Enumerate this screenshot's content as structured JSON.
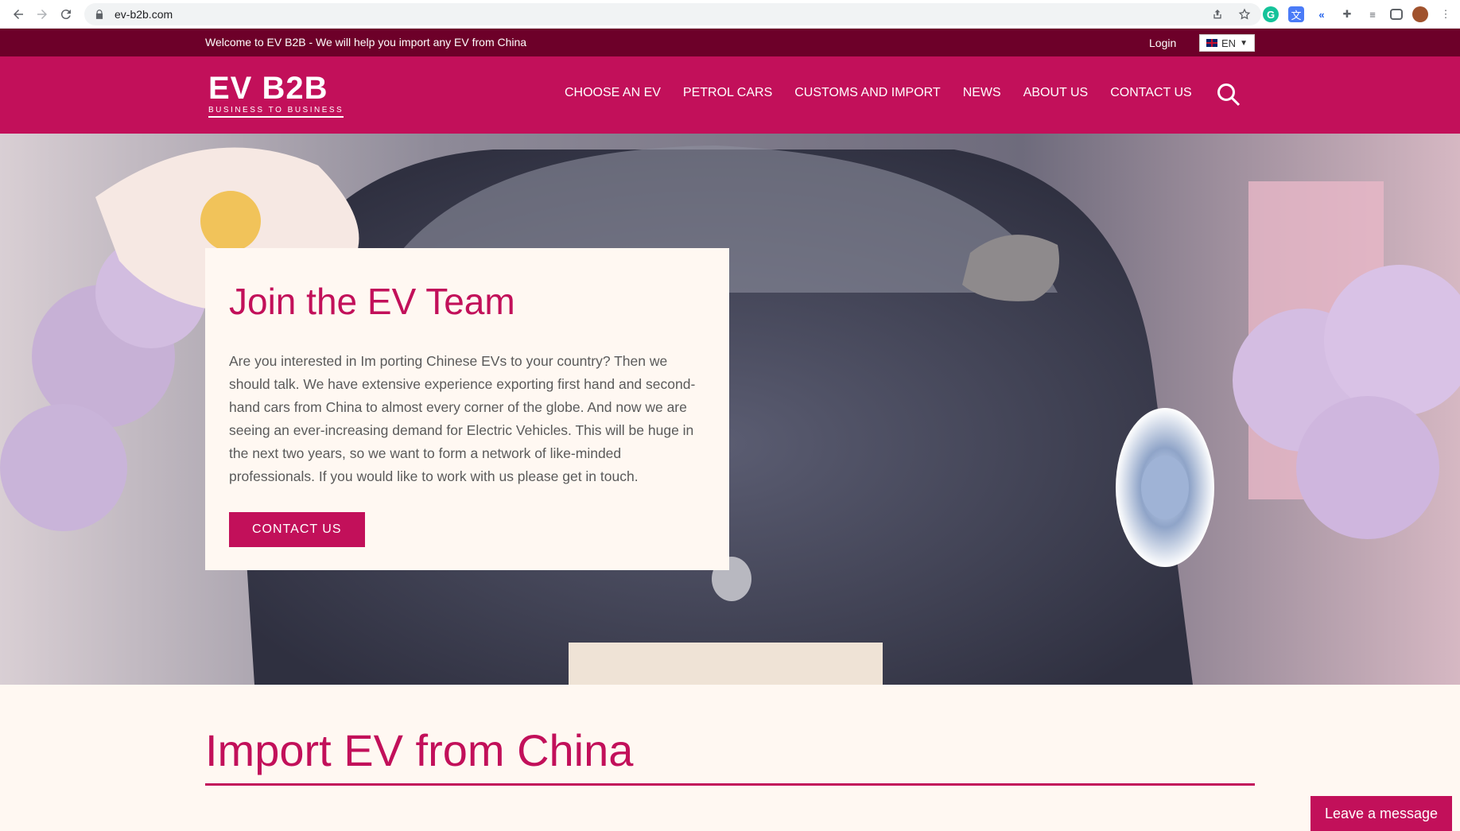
{
  "browser": {
    "url": "ev-b2b.com"
  },
  "topbar": {
    "welcome": "Welcome to EV B2B - We will help you import any EV from China",
    "login": "Login",
    "language": "EN"
  },
  "header": {
    "logo_main": "EV B2B",
    "logo_sub": "BUSINESS TO BUSINESS",
    "nav": [
      {
        "label": "CHOOSE AN EV"
      },
      {
        "label": "PETROL CARS"
      },
      {
        "label": "CUSTOMS AND IMPORT"
      },
      {
        "label": "NEWS"
      },
      {
        "label": "ABOUT US"
      },
      {
        "label": "CONTACT US"
      }
    ]
  },
  "hero": {
    "title": "Join the EV Team",
    "text": "Are you interested in Im porting Chinese EVs to your country? Then we should talk. We have extensive experience exporting first hand and second-hand cars from China to almost every corner of the globe. And now we are seeing an ever-increasing demand for Electric Vehicles. This will be huge in the next two years, so we want to form a network of like-minded professionals. If you would like to work with us please get in touch.",
    "button": "CONTACT US"
  },
  "section": {
    "title": "Import EV from China"
  },
  "chat": {
    "label": "Leave a message"
  },
  "colors": {
    "brand": "#c2105a",
    "topbar": "#6d0029",
    "background": "#fff8f2"
  }
}
